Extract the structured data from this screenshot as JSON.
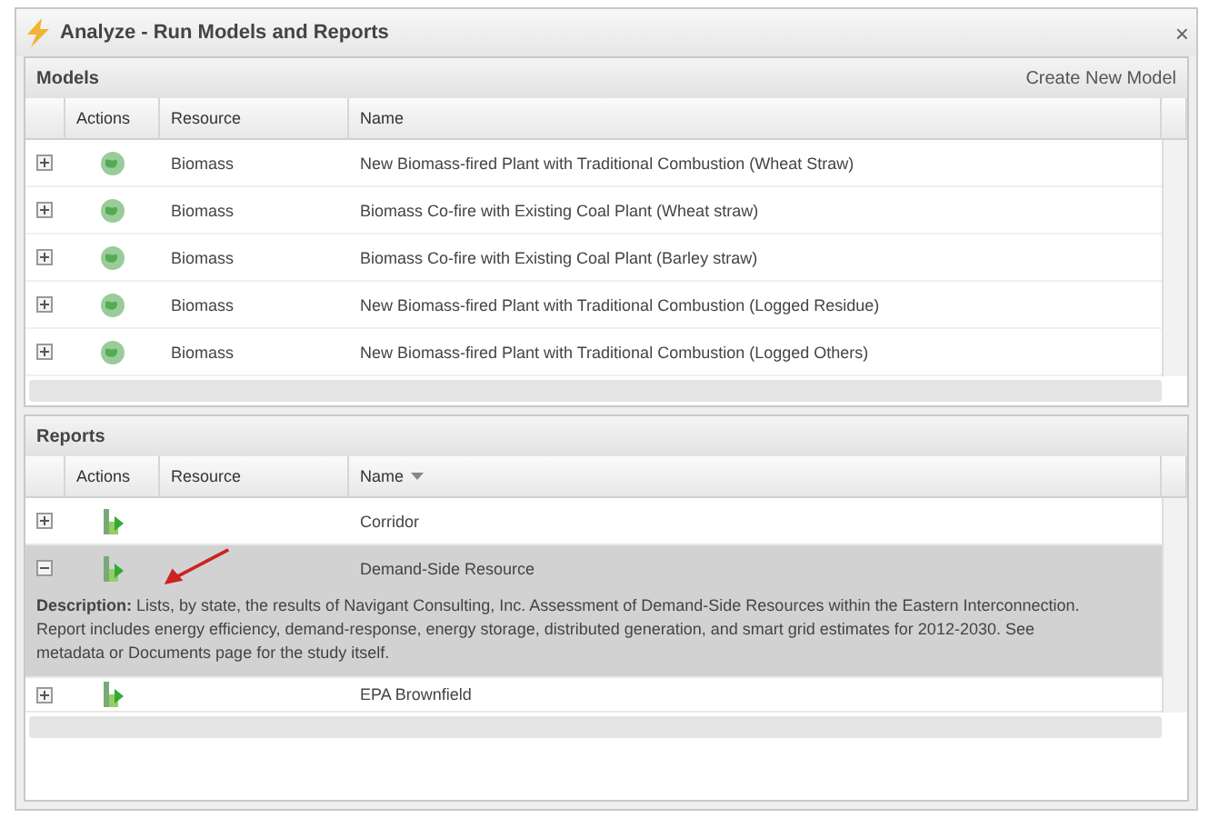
{
  "window": {
    "title": "Analyze - Run Models and Reports",
    "close": "×"
  },
  "models": {
    "title": "Models",
    "action": "Create New Model",
    "columns": [
      "Actions",
      "Resource",
      "Name"
    ],
    "rows": [
      {
        "expanded": false,
        "resource": "Biomass",
        "name": "New Biomass-fired Plant with Traditional Combustion (Wheat Straw)"
      },
      {
        "expanded": false,
        "resource": "Biomass",
        "name": "Biomass Co-fire with Existing Coal Plant (Wheat straw)"
      },
      {
        "expanded": false,
        "resource": "Biomass",
        "name": "Biomass Co-fire with Existing Coal Plant (Barley straw)"
      },
      {
        "expanded": false,
        "resource": "Biomass",
        "name": "New Biomass-fired Plant with Traditional Combustion (Logged Residue)"
      },
      {
        "expanded": false,
        "resource": "Biomass",
        "name": "New Biomass-fired Plant with Traditional Combustion (Logged Others)"
      }
    ]
  },
  "reports": {
    "title": "Reports",
    "columns": [
      "Actions",
      "Resource",
      "Name"
    ],
    "rows": [
      {
        "expanded": false,
        "selected": false,
        "name": "Corridor"
      },
      {
        "expanded": true,
        "selected": true,
        "name": "Demand-Side Resource",
        "description": "**Description:** Lists, by state, the results of Navigant Consulting, Inc. Assessment of Demand-Side Resources within the Eastern Interconnection. Report includes energy efficiency, demand-response, energy storage, distributed generation, and smart grid estimates for 2012-2030. See metadata or Documents page for the study itself."
      },
      {
        "expanded": false,
        "selected": false,
        "name": "EPA Brownfield"
      }
    ]
  }
}
